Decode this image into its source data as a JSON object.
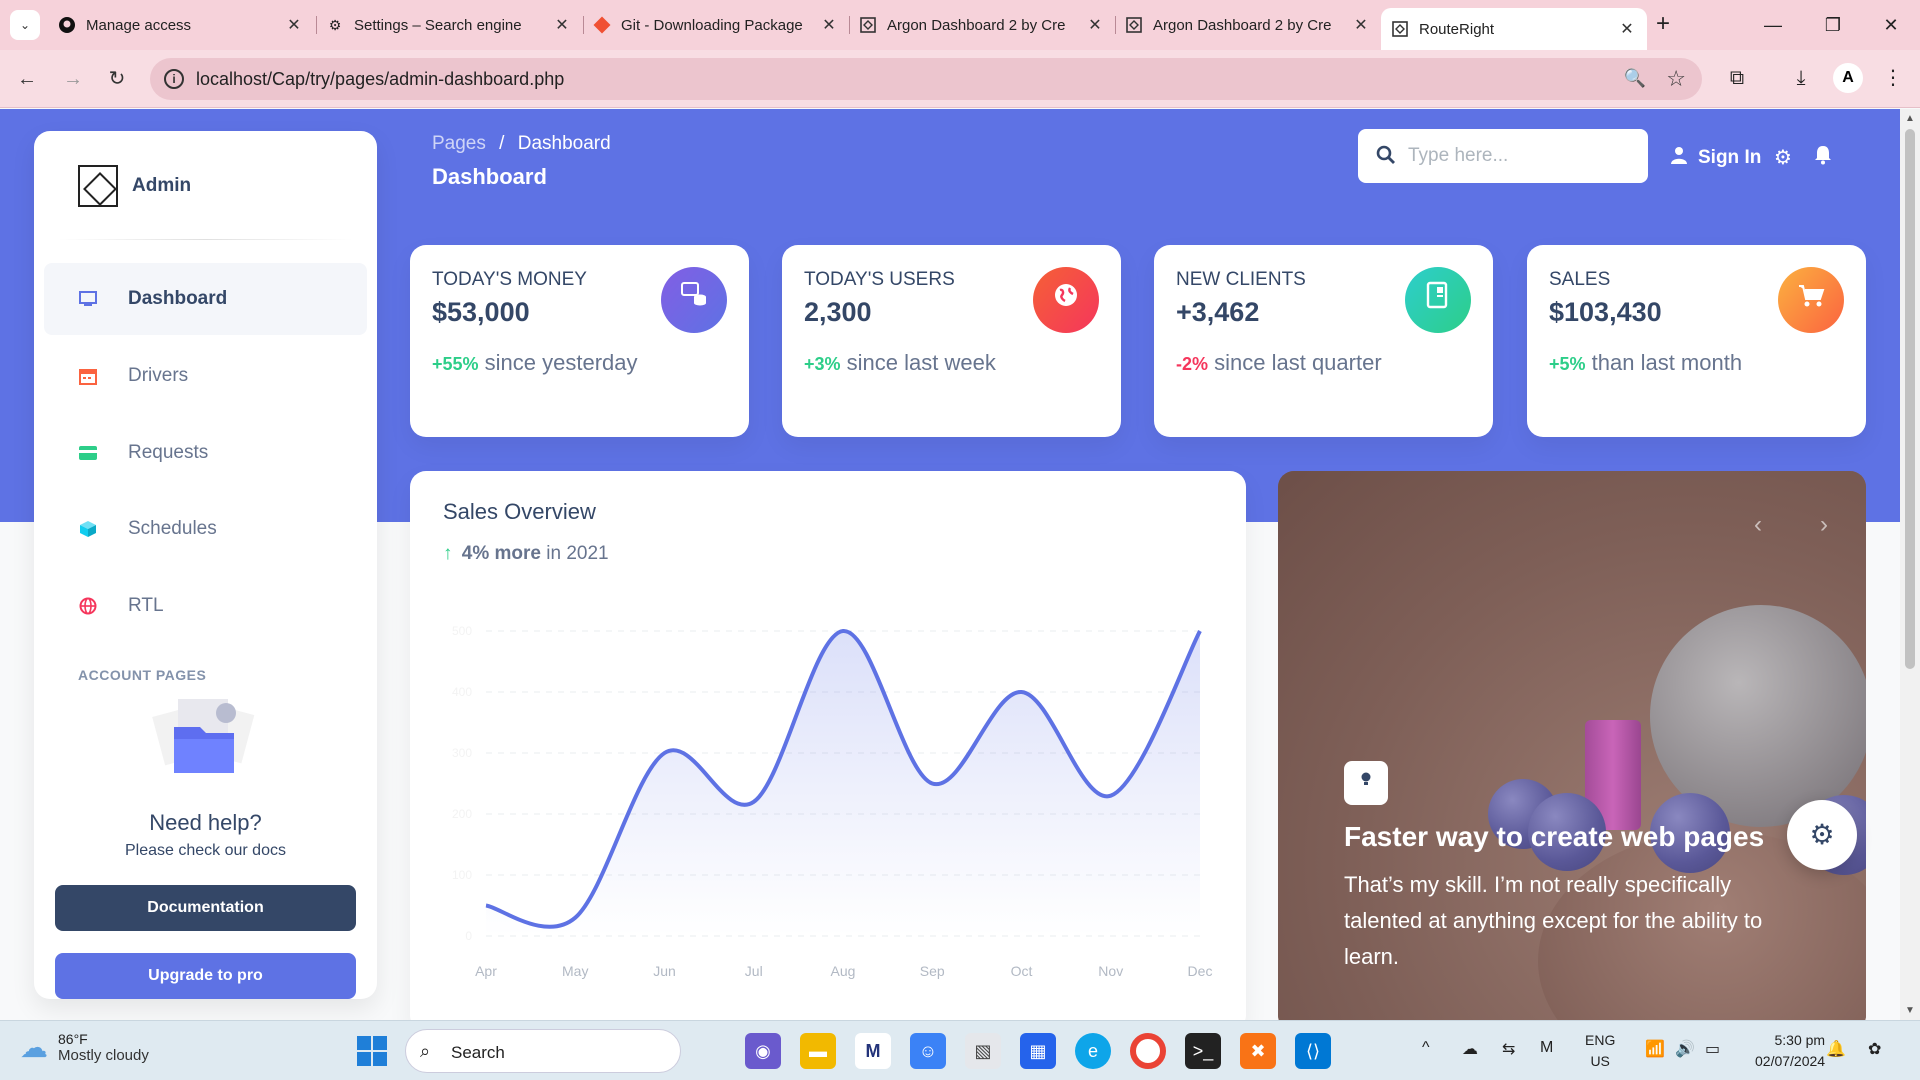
{
  "browser": {
    "tabs": [
      {
        "title": "Manage access",
        "icon": "github-icon"
      },
      {
        "title": "Settings – Search engine",
        "icon": "gear-icon"
      },
      {
        "title": "Git - Downloading Package",
        "icon": "git-icon"
      },
      {
        "title": "Argon Dashboard 2 by Cre",
        "icon": "argon-icon"
      },
      {
        "title": "Argon Dashboard 2 by Cre",
        "icon": "argon-icon"
      },
      {
        "title": "RouteRight",
        "icon": "argon-icon",
        "active": true
      }
    ],
    "url": "localhost/Cap/try/pages/admin-dashboard.php"
  },
  "sidebar": {
    "brand": "Admin",
    "items": [
      {
        "label": "Dashboard",
        "icon": "monitor-icon",
        "color": "#5e72e4",
        "active": true
      },
      {
        "label": "Drivers",
        "icon": "calendar-icon",
        "color": "#fb6340"
      },
      {
        "label": "Requests",
        "icon": "credit-card-icon",
        "color": "#2dce89"
      },
      {
        "label": "Schedules",
        "icon": "box-icon",
        "color": "#11cdef"
      },
      {
        "label": "RTL",
        "icon": "globe-icon",
        "color": "#f5365c"
      }
    ],
    "section_title": "ACCOUNT PAGES",
    "help_title": "Need help?",
    "help_sub": "Please check our docs",
    "doc_button": "Documentation",
    "pro_button": "Upgrade to pro"
  },
  "header": {
    "breadcrumb_parent": "Pages",
    "breadcrumb_sep": "/",
    "breadcrumb_current": "Dashboard",
    "title": "Dashboard",
    "search_placeholder": "Type here...",
    "signin": "Sign In"
  },
  "stats": [
    {
      "label": "TODAY'S MONEY",
      "value": "$53,000",
      "change": "+55%",
      "change_color": "#2dce89",
      "suffix": " since yesterday",
      "icon": "coins-icon",
      "icon_bg": "linear-gradient(310deg,#5e72e4,#825ee4)"
    },
    {
      "label": "TODAY'S USERS",
      "value": "2,300",
      "change": "+3%",
      "change_color": "#2dce89",
      "suffix": " since last week",
      "icon": "world-icon",
      "icon_bg": "linear-gradient(310deg,#f5365c,#f56036)"
    },
    {
      "label": "NEW CLIENTS",
      "value": "+3,462",
      "change": "-2%",
      "change_color": "#f5365c",
      "suffix": " since last quarter",
      "icon": "paper-icon",
      "icon_bg": "linear-gradient(310deg,#2dce89,#2dcecc)"
    },
    {
      "label": "SALES",
      "value": "$103,430",
      "change": "+5%",
      "change_color": "#2dce89",
      "suffix": " than last month",
      "icon": "cart-icon",
      "icon_bg": "linear-gradient(310deg,#fb6340,#fbb140)"
    }
  ],
  "sales": {
    "title": "Sales Overview",
    "change": "4% more",
    "period": " in 2021"
  },
  "chart_data": {
    "type": "line",
    "categories": [
      "Apr",
      "May",
      "Jun",
      "Jul",
      "Aug",
      "Sep",
      "Oct",
      "Nov",
      "Dec"
    ],
    "series": [
      {
        "values": [
          50,
          30,
          300,
          220,
          500,
          250,
          400,
          230,
          500
        ]
      }
    ],
    "ylim": [
      0,
      500
    ],
    "yticks": [
      0,
      100,
      200,
      300,
      400,
      500
    ],
    "color": "#5e72e4",
    "grid": true
  },
  "carousel": {
    "title": "Faster way to create web pages",
    "text": "That’s my skill. I’m not really specifically talented at anything except for the ability to learn.",
    "badge_icon": "bulb-icon"
  },
  "taskbar": {
    "temp": "86°F",
    "condition": "Mostly cloudy",
    "search": "Search",
    "lang_line1": "ENG",
    "lang_line2": "US",
    "time": "5:30 pm",
    "date": "02/07/2024"
  }
}
